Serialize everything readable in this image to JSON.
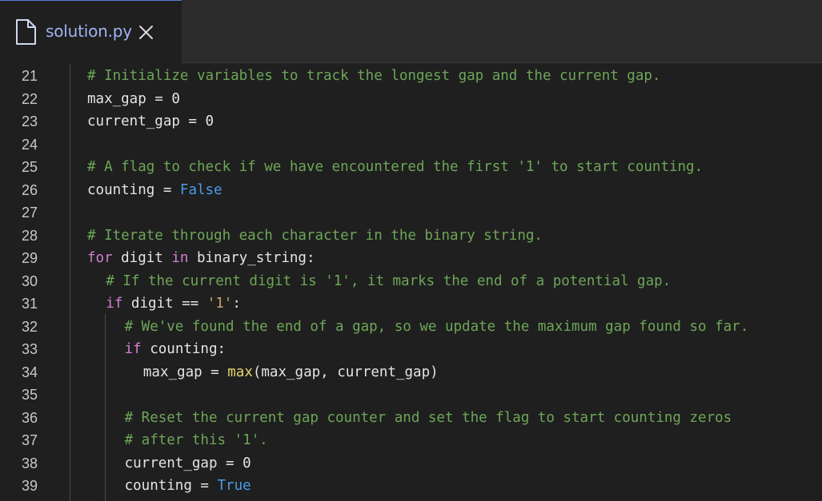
{
  "tab": {
    "filename": "solution.py",
    "file_icon": "file-icon",
    "close_icon": "close-icon"
  },
  "colors": {
    "comment": "#6ea658",
    "keyword": "#d17fd1",
    "boolean": "#4a9be8",
    "string": "#c8a46a",
    "function": "#e7d36e",
    "text": "#e4e4e4",
    "tab_accent": "#5a7bd8"
  },
  "lines": [
    {
      "n": "21",
      "indent": 0,
      "tokens": [
        {
          "t": "# Initialize variables to track the longest gap and the current gap.",
          "c": "cmt"
        }
      ]
    },
    {
      "n": "22",
      "indent": 0,
      "tokens": [
        {
          "t": "max_gap = ",
          "c": ""
        },
        {
          "t": "0",
          "c": "num"
        }
      ]
    },
    {
      "n": "23",
      "indent": 0,
      "tokens": [
        {
          "t": "current_gap = ",
          "c": ""
        },
        {
          "t": "0",
          "c": "num"
        }
      ]
    },
    {
      "n": "24",
      "indent": 0,
      "tokens": []
    },
    {
      "n": "25",
      "indent": 0,
      "tokens": [
        {
          "t": "# A flag to check if we have encountered the first '1' to start counting.",
          "c": "cmt"
        }
      ]
    },
    {
      "n": "26",
      "indent": 0,
      "tokens": [
        {
          "t": "counting = ",
          "c": ""
        },
        {
          "t": "False",
          "c": "bool"
        }
      ]
    },
    {
      "n": "27",
      "indent": 0,
      "tokens": []
    },
    {
      "n": "28",
      "indent": 0,
      "tokens": [
        {
          "t": "# Iterate through each character in the binary string.",
          "c": "cmt"
        }
      ]
    },
    {
      "n": "29",
      "indent": 0,
      "tokens": [
        {
          "t": "for",
          "c": "kw"
        },
        {
          "t": " digit ",
          "c": ""
        },
        {
          "t": "in",
          "c": "kw"
        },
        {
          "t": " binary_string:",
          "c": ""
        }
      ]
    },
    {
      "n": "30",
      "indent": 1,
      "tokens": [
        {
          "t": "# If the current digit is '1', it marks the end of a potential gap.",
          "c": "cmt"
        }
      ]
    },
    {
      "n": "31",
      "indent": 1,
      "tokens": [
        {
          "t": "if",
          "c": "kw"
        },
        {
          "t": " digit == ",
          "c": ""
        },
        {
          "t": "'1'",
          "c": "str"
        },
        {
          "t": ":",
          "c": ""
        }
      ]
    },
    {
      "n": "32",
      "indent": 2,
      "tokens": [
        {
          "t": "# We've found the end of a gap, so we update the maximum gap found so far.",
          "c": "cmt"
        }
      ]
    },
    {
      "n": "33",
      "indent": 2,
      "tokens": [
        {
          "t": "if",
          "c": "kw"
        },
        {
          "t": " counting:",
          "c": ""
        }
      ]
    },
    {
      "n": "34",
      "indent": 3,
      "tokens": [
        {
          "t": "max_gap = ",
          "c": ""
        },
        {
          "t": "max",
          "c": "fn"
        },
        {
          "t": "(max_gap, current_gap)",
          "c": ""
        }
      ]
    },
    {
      "n": "35",
      "indent": 0,
      "tokens": []
    },
    {
      "n": "36",
      "indent": 2,
      "tokens": [
        {
          "t": "# Reset the current gap counter and set the flag to start counting zeros",
          "c": "cmt"
        }
      ]
    },
    {
      "n": "37",
      "indent": 2,
      "tokens": [
        {
          "t": "# after this '1'.",
          "c": "cmt"
        }
      ]
    },
    {
      "n": "38",
      "indent": 2,
      "tokens": [
        {
          "t": "current_gap = ",
          "c": ""
        },
        {
          "t": "0",
          "c": "num"
        }
      ]
    },
    {
      "n": "39",
      "indent": 2,
      "tokens": [
        {
          "t": "counting = ",
          "c": ""
        },
        {
          "t": "True",
          "c": "bool"
        }
      ]
    }
  ]
}
